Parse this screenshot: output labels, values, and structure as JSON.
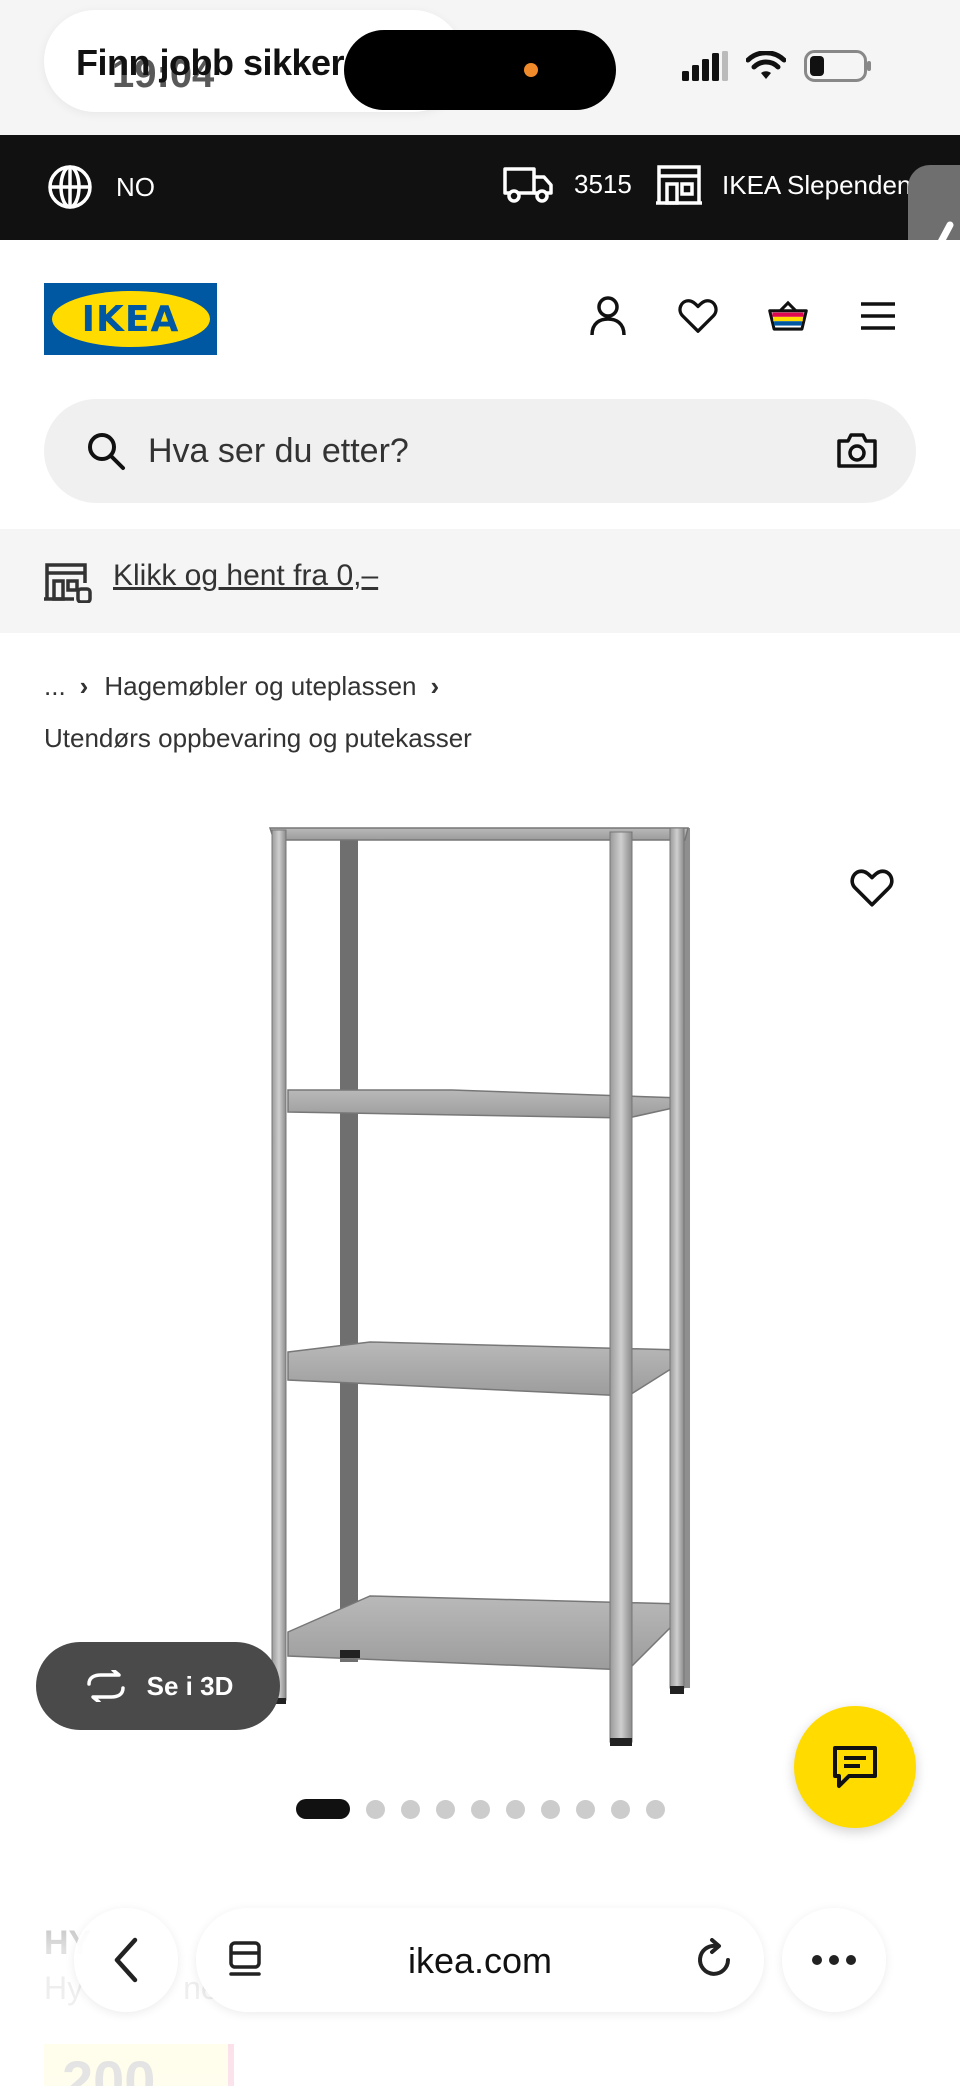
{
  "status_bar": {
    "notification": "Finn jobb sikker",
    "time": "19:04"
  },
  "topbar": {
    "language": "NO",
    "postcode": "3515",
    "store": "IKEA Slependen"
  },
  "header": {
    "logo_text": "IKEA"
  },
  "search": {
    "placeholder": "Hva ser du etter?"
  },
  "promo": {
    "link_text": "Klikk og hent fra 0,–"
  },
  "breadcrumb": {
    "ellipsis": "...",
    "item1": "Hagemøbler og uteplassen",
    "item2": "Utendørs oppbevaring og putekasser"
  },
  "product": {
    "see_3d_label": "Se i 3D",
    "title_partial": "HY",
    "subtitle_partial": "Hy",
    "subtitle_partial_end": "ne",
    "price_partial": "200",
    "image_count": 10,
    "active_image": 1
  },
  "browser": {
    "domain": "ikea.com"
  },
  "colors": {
    "ikea_blue": "#0058a3",
    "ikea_yellow": "#ffdb00",
    "topbar_bg": "#111111"
  }
}
